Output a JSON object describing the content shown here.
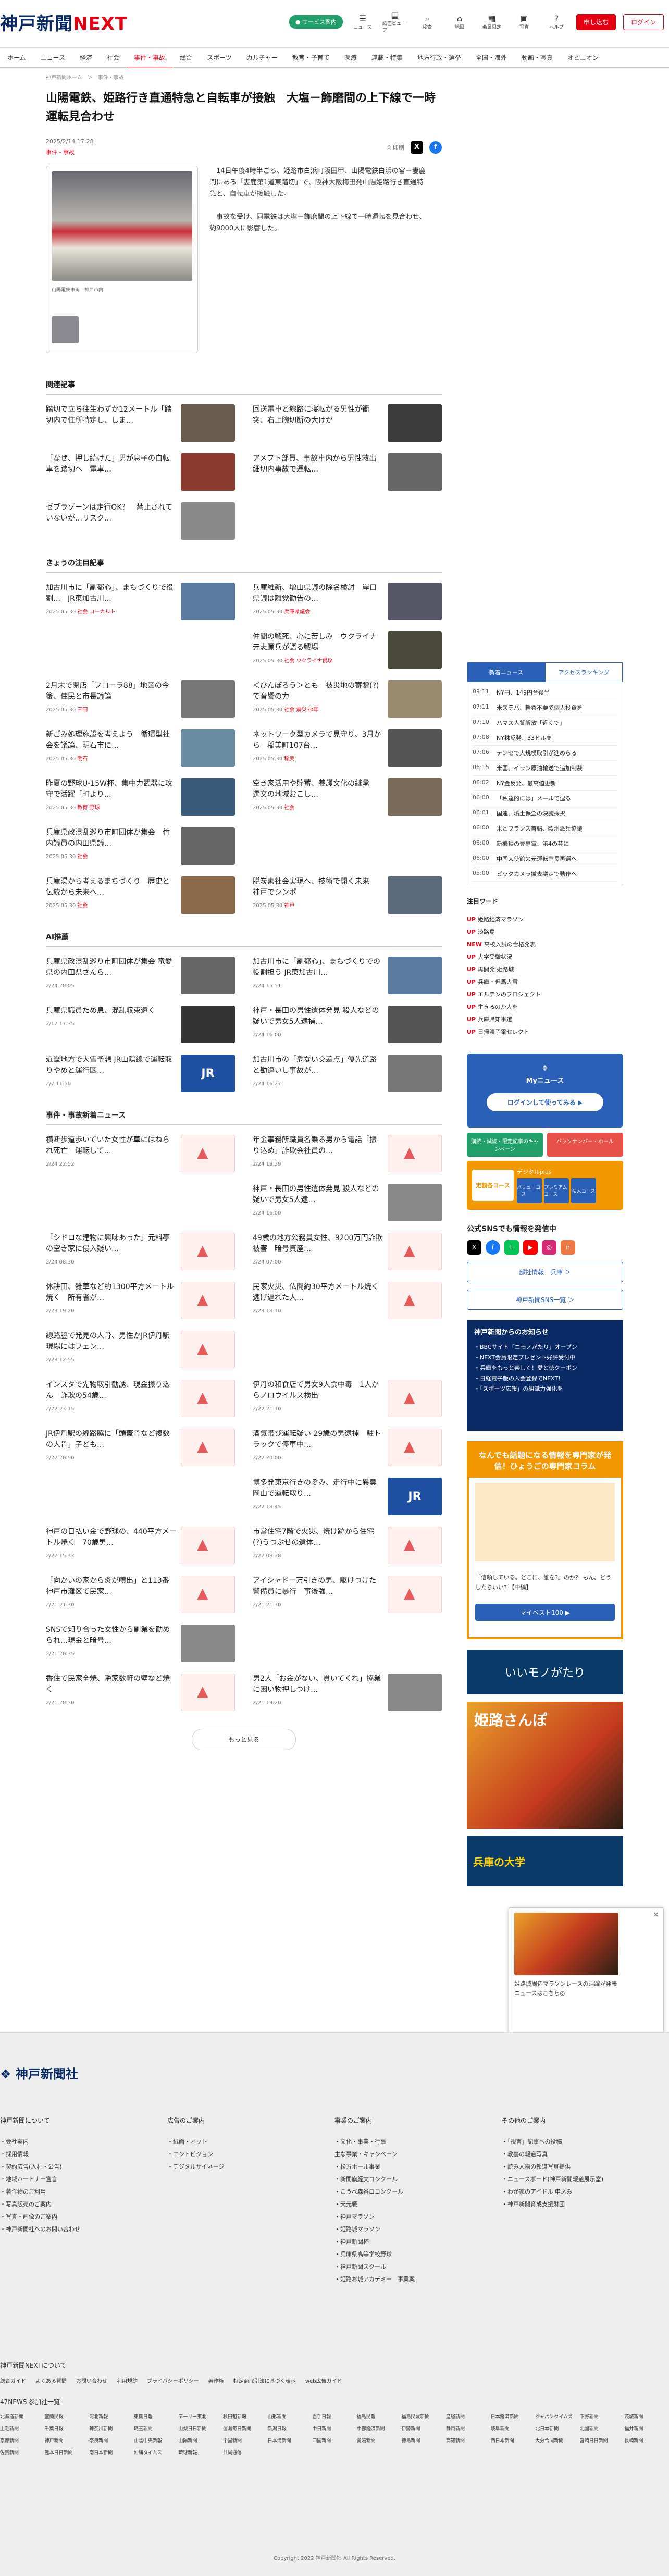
{
  "header": {
    "logo_main": "神戸新聞",
    "logo_next": "NEXT",
    "pill": "● サービス案内",
    "icons": [
      {
        "g": "☰",
        "l": "ニュース"
      },
      {
        "g": "▤",
        "l": "紙面ビューア"
      },
      {
        "g": "⌕",
        "l": "検索"
      },
      {
        "g": "⌂",
        "l": "地図"
      },
      {
        "g": "▦",
        "l": "会員限定"
      },
      {
        "g": "▣",
        "l": "写真"
      },
      {
        "g": "?",
        "l": "ヘルプ"
      }
    ],
    "register": "申し込む",
    "login": "ログイン"
  },
  "nav": [
    "ホーム",
    "ニュース",
    "経済",
    "社会",
    "事件・事故",
    "総合",
    "スポーツ",
    "カルチャー",
    "教育・子育て",
    "医療",
    "連載・特集",
    "地方行政・選挙",
    "全国・海外",
    "動画・写真",
    "オピニオン"
  ],
  "nav_active": 4,
  "crumb": "神戸新聞ホーム　＞　事件・事故",
  "article": {
    "title": "山陽電鉄、姫路行き直通特急と自転車が接触　大塩－飾磨間の上下線で一時運転見合わせ",
    "date": "2025/2/14 17:28",
    "tag": "事件・事故",
    "print": "印刷",
    "photo_caption": "山陽電鉄車両＝神戸市内",
    "paras": [
      "14日午後4時半ごろ、姫路市白浜町阪田甲、山陽電鉄白浜の宮－妻鹿間にある「妻鹿第1道東踏切」で、阪神大阪梅田発山陽姫路行き直通特急と、自転車が接触した。",
      "事故を受け、同電鉄は大塩－飾磨間の上下線で一時運転を見合わせ、約9000人に影響した。"
    ]
  },
  "related": {
    "heading": "関連記事",
    "items": [
      {
        "t": "踏切で立ち往生わずか12メートル「踏切内で住所特定し、しま…",
        "c": "#6a5c4e"
      },
      {
        "t": "回送電車と線路に寝転がる男性が衝突、右上腕切断の大けが",
        "c": "#3b3b3b"
      },
      {
        "t": "「なぜ、押し続けた」男が息子の自転車を踏切へ　電車…",
        "c": "#8a3a2e"
      },
      {
        "t": "アメフト部員、事故車内から男性救出　細切内事故で運転…",
        "c": "#666"
      },
      {
        "t": "ゼブラゾーンは走行OK？　禁止されていないが…リスク…",
        "c": "#888"
      }
    ]
  },
  "today": {
    "heading": "きょうの注目記事",
    "items": [
      {
        "t": "加古川市に「副都心」、まちづくりで役割…　JR東加古川…",
        "d": "2025.05.30",
        "c": "社会",
        "cc": "コーカルト",
        "col": "#5a7aa0"
      },
      {
        "t": "兵庫維新、増山県議の除名検討　岸口県議は離党勧告の…",
        "d": "2025.05.30",
        "c": "兵庫県議会",
        "col": "#556"
      },
      {
        "t": "",
        "d": "",
        "c": "",
        "cc": "",
        "col": ""
      },
      {
        "t": "仲間の戦死、心に苦しみ　ウクライナ元志願兵が語る戦場",
        "d": "2025.05.30",
        "c": "社会",
        "cc": "ウクライナ侵攻",
        "col": "#4a4a3a"
      },
      {
        "t": "2月末で閉店「フローラ88」地区の今後、住民と市長議論",
        "d": "2025.05.30",
        "c": "三田",
        "col": "#777"
      },
      {
        "t": "＜ぴんぽろう＞とも　被災地の寄贈(?)で音響の力",
        "d": "2025.05.30",
        "c": "社会",
        "cc": "震災30年",
        "col": "#9a8a70"
      },
      {
        "t": "新ごみ処理施設を考えよう　循環型社会を議論、明石市に…",
        "d": "2025.05.30",
        "c": "明石",
        "col": "#6a8aa0"
      },
      {
        "t": "ネットワーク型カメラで見守り、3月から　稲美町107台…",
        "d": "2025.05.30",
        "c": "稲美",
        "col": "#555"
      },
      {
        "t": "昨夏の野球U-15W杯、集中力武器に攻守で活躍「町より…",
        "d": "2025.05.30",
        "c": "教育",
        "cc": "野球",
        "col": "#3a5a7a"
      },
      {
        "t": "空き家活用や貯蓄、養護文化の継承　選文の地域おこし…",
        "d": "2025.05.30",
        "c": "社会",
        "col": "#7a6a5a"
      },
      {
        "t": "兵庫県政混乱巡り市町団体が集会　竹内議員の内田県議…",
        "d": "2025.05.30",
        "c": "社会",
        "col": "#666"
      },
      {
        "t": "",
        "d": "",
        "c": "",
        "col": ""
      },
      {
        "t": "兵庫湯から考えるまちづくり　歴史と伝統から未来へ…",
        "d": "2025.05.30",
        "c": "社会",
        "col": "#8a6a4a"
      },
      {
        "t": "脱炭素社会実現へ、技術で開く未来　神戸でシンポ",
        "d": "2025.05.30",
        "c": "神戸",
        "col": "#5a6a7a"
      }
    ]
  },
  "ai": {
    "heading": "AI推薦",
    "items": [
      {
        "t": "兵庫県政混乱巡り市町団体が集会 竜愛県の内田県さんら…",
        "d": "2/24 20:05",
        "col": "#666"
      },
      {
        "t": "加古川市に「副都心」、まちづくりでの役割担う JR東加古川…",
        "d": "2/24 15:51",
        "col": "#5a7aa0"
      },
      {
        "t": "兵庫県職員ため息、混乱収束遠く",
        "d": "2/17 17:35",
        "col": "#333"
      },
      {
        "t": "神戸・長田の男性遺体発見 殺人などの疑いで男女5人逮捕…",
        "d": "2/24 16:00",
        "col": "#555"
      },
      {
        "t": "近畿地方で大雪予想 JR山陽線で運転取りやめと運行区…",
        "d": "2/7 11:50",
        "col": "#1f4fa0",
        "jr": true
      },
      {
        "t": "加古川市の「危ない交差点」優先道路と勘違いし事故が…",
        "d": "2/24 16:27",
        "col": "#777"
      }
    ]
  },
  "incidents": {
    "heading": "事件・事故新着ニュース",
    "more": "もっと見る",
    "items": [
      {
        "t": "横断歩道歩いていた女性が車にはねられ死亡　運転して…",
        "d": "2/24 22:52",
        "map": true
      },
      {
        "t": "年金事務所職員名乗る男から電話「振り込め」詐欺会社員の…",
        "d": "2/24 19:39",
        "map": true
      },
      {
        "t": "",
        "d": "",
        "map": false
      },
      {
        "t": "神戸・長田の男性遺体発見 殺人などの疑いで男女5人逮…",
        "d": "2/24 16:00",
        "map": false
      },
      {
        "t": "「シドロな建物に興味あった」元料亭の空き家に侵入疑い…",
        "d": "2/24 08:30",
        "map": true
      },
      {
        "t": "49歳の地方公務員女性、9200万円詐欺被害　暗号資産…",
        "d": "2/24 07:00",
        "map": true
      },
      {
        "t": "休耕田、雑草など約1300平方メートル焼く　所有者が…",
        "d": "2/23 19:20",
        "map": true
      },
      {
        "t": "民家火災、仏間約30平方メートル焼く　逃げ遅れた人…",
        "d": "2/23 18:10",
        "map": true
      },
      {
        "t": "線路脇で発見の人骨、男性かJR伊丹駅　現場にはフェン…",
        "d": "2/23 12:55",
        "map": true
      },
      {
        "t": "",
        "d": "",
        "map": false
      },
      {
        "t": "インスタで先物取引勧誘、現金振り込ん　詐欺の54歳…",
        "d": "2/22 23:15",
        "map": true
      },
      {
        "t": "伊丹の和食店で男女9人食中毒　1人からノロウイルス検出",
        "d": "2/22 21:10",
        "map": true
      },
      {
        "t": "JR伊丹駅の線路脇に「頭蓋骨など複数の人骨」子ども…",
        "d": "2/22 20:50",
        "map": true
      },
      {
        "t": "酒気帯び運転疑い 29歳の男逮捕　駐トラックで停車中…",
        "d": "2/22 20:00",
        "map": true
      },
      {
        "t": "",
        "d": "",
        "map": false
      },
      {
        "t": "博多発東京行きのぞみ、走行中に異臭　岡山で運転取り…",
        "d": "2/22 18:45",
        "jr": true
      },
      {
        "t": "神戸の日払い金で野球の、440平方メートル焼く　70歳男…",
        "d": "2/22 15:33",
        "map": true
      },
      {
        "t": "市営住宅7階で火災、焼け跡から住宅(?)うつぶせの遺体…",
        "d": "2/22 08:38",
        "map": true
      },
      {
        "t": "「向かいの家から炎が噴出」と113番　神戸市灘区で民家…",
        "d": "2/21 21:30",
        "map": true
      },
      {
        "t": "アイシャドー万引きの男、駆けつけた警備員に暴行　事後強…",
        "d": "2/21 21:30",
        "map": true
      },
      {
        "t": "SNSで知り合った女性から副業を勧められ…現金と暗号…",
        "d": "2/21 20:35",
        "map": false
      },
      {
        "t": "",
        "d": "",
        "map": false
      },
      {
        "t": "香住で民家全焼、隣家数軒の壁など焼く",
        "d": "2/21 20:30",
        "map": true
      },
      {
        "t": "男2人「お金がない、貫いてくれ」協業に困い物押しつけ…",
        "d": "2/21 19:20",
        "map": false
      }
    ]
  },
  "side": {
    "tabs": [
      "新着ニュース",
      "アクセスランキング"
    ],
    "ranks": [
      {
        "t": "09:11",
        "h": "NY円、149円台後半"
      },
      {
        "t": "07:11",
        "h": "米ステバ、軽柔不要で個人投資を"
      },
      {
        "t": "07:10",
        "h": "ハマス人質解放「近くで」"
      },
      {
        "t": "07:08",
        "h": "NY株反発、33ドル高"
      },
      {
        "t": "07:06",
        "h": "テンセで大規模取引が進めらる"
      },
      {
        "t": "06:15",
        "h": "米国、イラン原油輸送で追加制裁"
      },
      {
        "t": "06:02",
        "h": "NY金反発、最高値更新"
      },
      {
        "t": "06:00",
        "h": "「私達的には」メールで湿る"
      },
      {
        "t": "06:01",
        "h": "国連、墳土保全の決議採択"
      },
      {
        "t": "06:00",
        "h": "米とフランス首脳、欧州派兵協議"
      },
      {
        "t": "06:00",
        "h": "新機種の豊専電、第4の芸に"
      },
      {
        "t": "06:00",
        "h": "中国大使館の元運転室長再選へ"
      },
      {
        "t": "05:00",
        "h": "ピックカメラ撤去議定で動作へ"
      }
    ],
    "promo_h": "注目ワード",
    "promos": [
      "UP 姫路経済マラソン",
      "UP 淡路島",
      "NEW 高校入試の合格発表",
      "UP 大学受験状況",
      "UP 再開発 姫路城",
      "UP 兵庫・但馬大雪",
      "UP エルテンのプロジェクト",
      "UP 生きるのか人を",
      "UP 兵庫県知事選",
      "UP 日帰渡子電セレクト"
    ],
    "my": "Myニュース",
    "my_btn": "ログインして使ってみる ▶",
    "tw1": "購読・試読・限定記事のキャンペーン",
    "tw2": "バックナンバー・ホール",
    "or1": "定額各コース",
    "or2": "デジタルplus",
    "or3": "バリューコース",
    "or4": "プレミアムコース",
    "or5": "法人コース",
    "sns_h": "公式SNSでも情報を発信中",
    "sns_b1": "部社情報　兵庫 ＞",
    "sns_b2": "神戸新聞SNS一覧 ＞",
    "notice_h": "神戸新聞からのお知らせ",
    "notices": [
      "・BBCサイト「ニモノがたり」オープン",
      "・NEXT会員限定プレゼント好評受付中",
      "・兵庫をもっと楽しく！愛と徳クーポン",
      "・日経電子版の入会登録でNEXT!",
      "・「スポーツ広報」の組織力強化を"
    ],
    "yorozu_t": "なんでも話題になる情報を専門家が発信！ひょうごの専門家コラム",
    "yorozu_x": "「信頼している。どこに、誰を?」のか？ もん。どうしたらいい? 【中編】",
    "yorozu_b": "マイベスト100 ▶",
    "ban1": "いいモノがたり",
    "ban2": "姫路さんぽ",
    "ban3": "兵庫の大学"
  },
  "popup": {
    "text": "姫路城周辺マラソンレースの活躍が発表ニュースはこちら◎",
    "close": "×"
  },
  "footer": {
    "logo": "神戸新聞社",
    "cols": [
      {
        "h": "神戸新聞について",
        "i": [
          "・会社案内",
          "・採用情報",
          "・契約広告(入札・公告)",
          "・地域ハートナー宣言",
          "・著作物のご利用",
          "・写真販売のご案内",
          "・写真・画像のご案内",
          "・神戸新聞社へのお問い合わせ"
        ]
      },
      {
        "h": "広告のご案内",
        "i": [
          "・紙面・ネット",
          "・エントビジョン",
          "・デジタルサイネージ"
        ]
      },
      {
        "h": "事業のご案内",
        "i": [
          "・文化・事業・行事",
          "主な事業・キャンペーン",
          "・松方ホール事業",
          "・新聞旗経文コンクール",
          "・こうべ森谷ロコンクール",
          "・天元戦",
          "・神戸マラソン",
          "・姫路城マラソン",
          "・神戸新聞杯",
          "・兵庫県高等学校野球",
          "・神戸新聞スクール",
          "・姫路お城アカデミー　事業案"
        ]
      },
      {
        "h": "その他のご案内",
        "i": [
          "・「視言」記事への投稿",
          "・教養の報道写真",
          "・読み人物の報道写真提供",
          "・ニュースボード(神戸新聞報道展示室)",
          "・わが家のアイドル 申込み",
          "・神戸新聞育成支援財団"
        ]
      }
    ],
    "next_h": "神戸新聞NEXTについて",
    "next_links": [
      "総合ガイド",
      "よくある質問",
      "お問い合わせ",
      "利用規約",
      "プライバシーポリシー",
      "著作権",
      "特定商取引法に基づく表示",
      "web広告ガイド"
    ],
    "mem_h": "47NEWS 参加社一覧",
    "members": [
      "北海道新聞",
      "室蘭民報",
      "河北新報",
      "東奥日報",
      "デーリー東北",
      "秋田魁新報",
      "山形新聞",
      "岩手日報",
      "福島民報",
      "福島民友新聞",
      "産経新聞",
      "日本経済新聞",
      "ジャパンタイムズ",
      "下野新聞",
      "茨城新聞",
      "上毛新聞",
      "千葉日報",
      "神奈川新聞",
      "埼玉新聞",
      "山梨日日新聞",
      "信濃毎日新聞",
      "新潟日報",
      "中日新聞",
      "中部経済新聞",
      "伊勢新聞",
      "静岡新聞",
      "岐阜新聞",
      "北日本新聞",
      "北國新聞",
      "福井新聞",
      "京都新聞",
      "神戸新聞",
      "奈良新聞",
      "山陰中央新報",
      "山陽新聞",
      "中国新聞",
      "日本海新聞",
      "四国新聞",
      "愛媛新聞",
      "徳島新聞",
      "高知新聞",
      "西日本新聞",
      "大分合同新聞",
      "宮崎日日新聞",
      "長崎新聞",
      "佐賀新聞",
      "熊本日日新聞",
      "南日本新聞",
      "沖縄タイムス",
      "琉球新報",
      "共同通信"
    ],
    "copy": "Copyright 2022 神戸新聞社 All Rights Reserved."
  }
}
